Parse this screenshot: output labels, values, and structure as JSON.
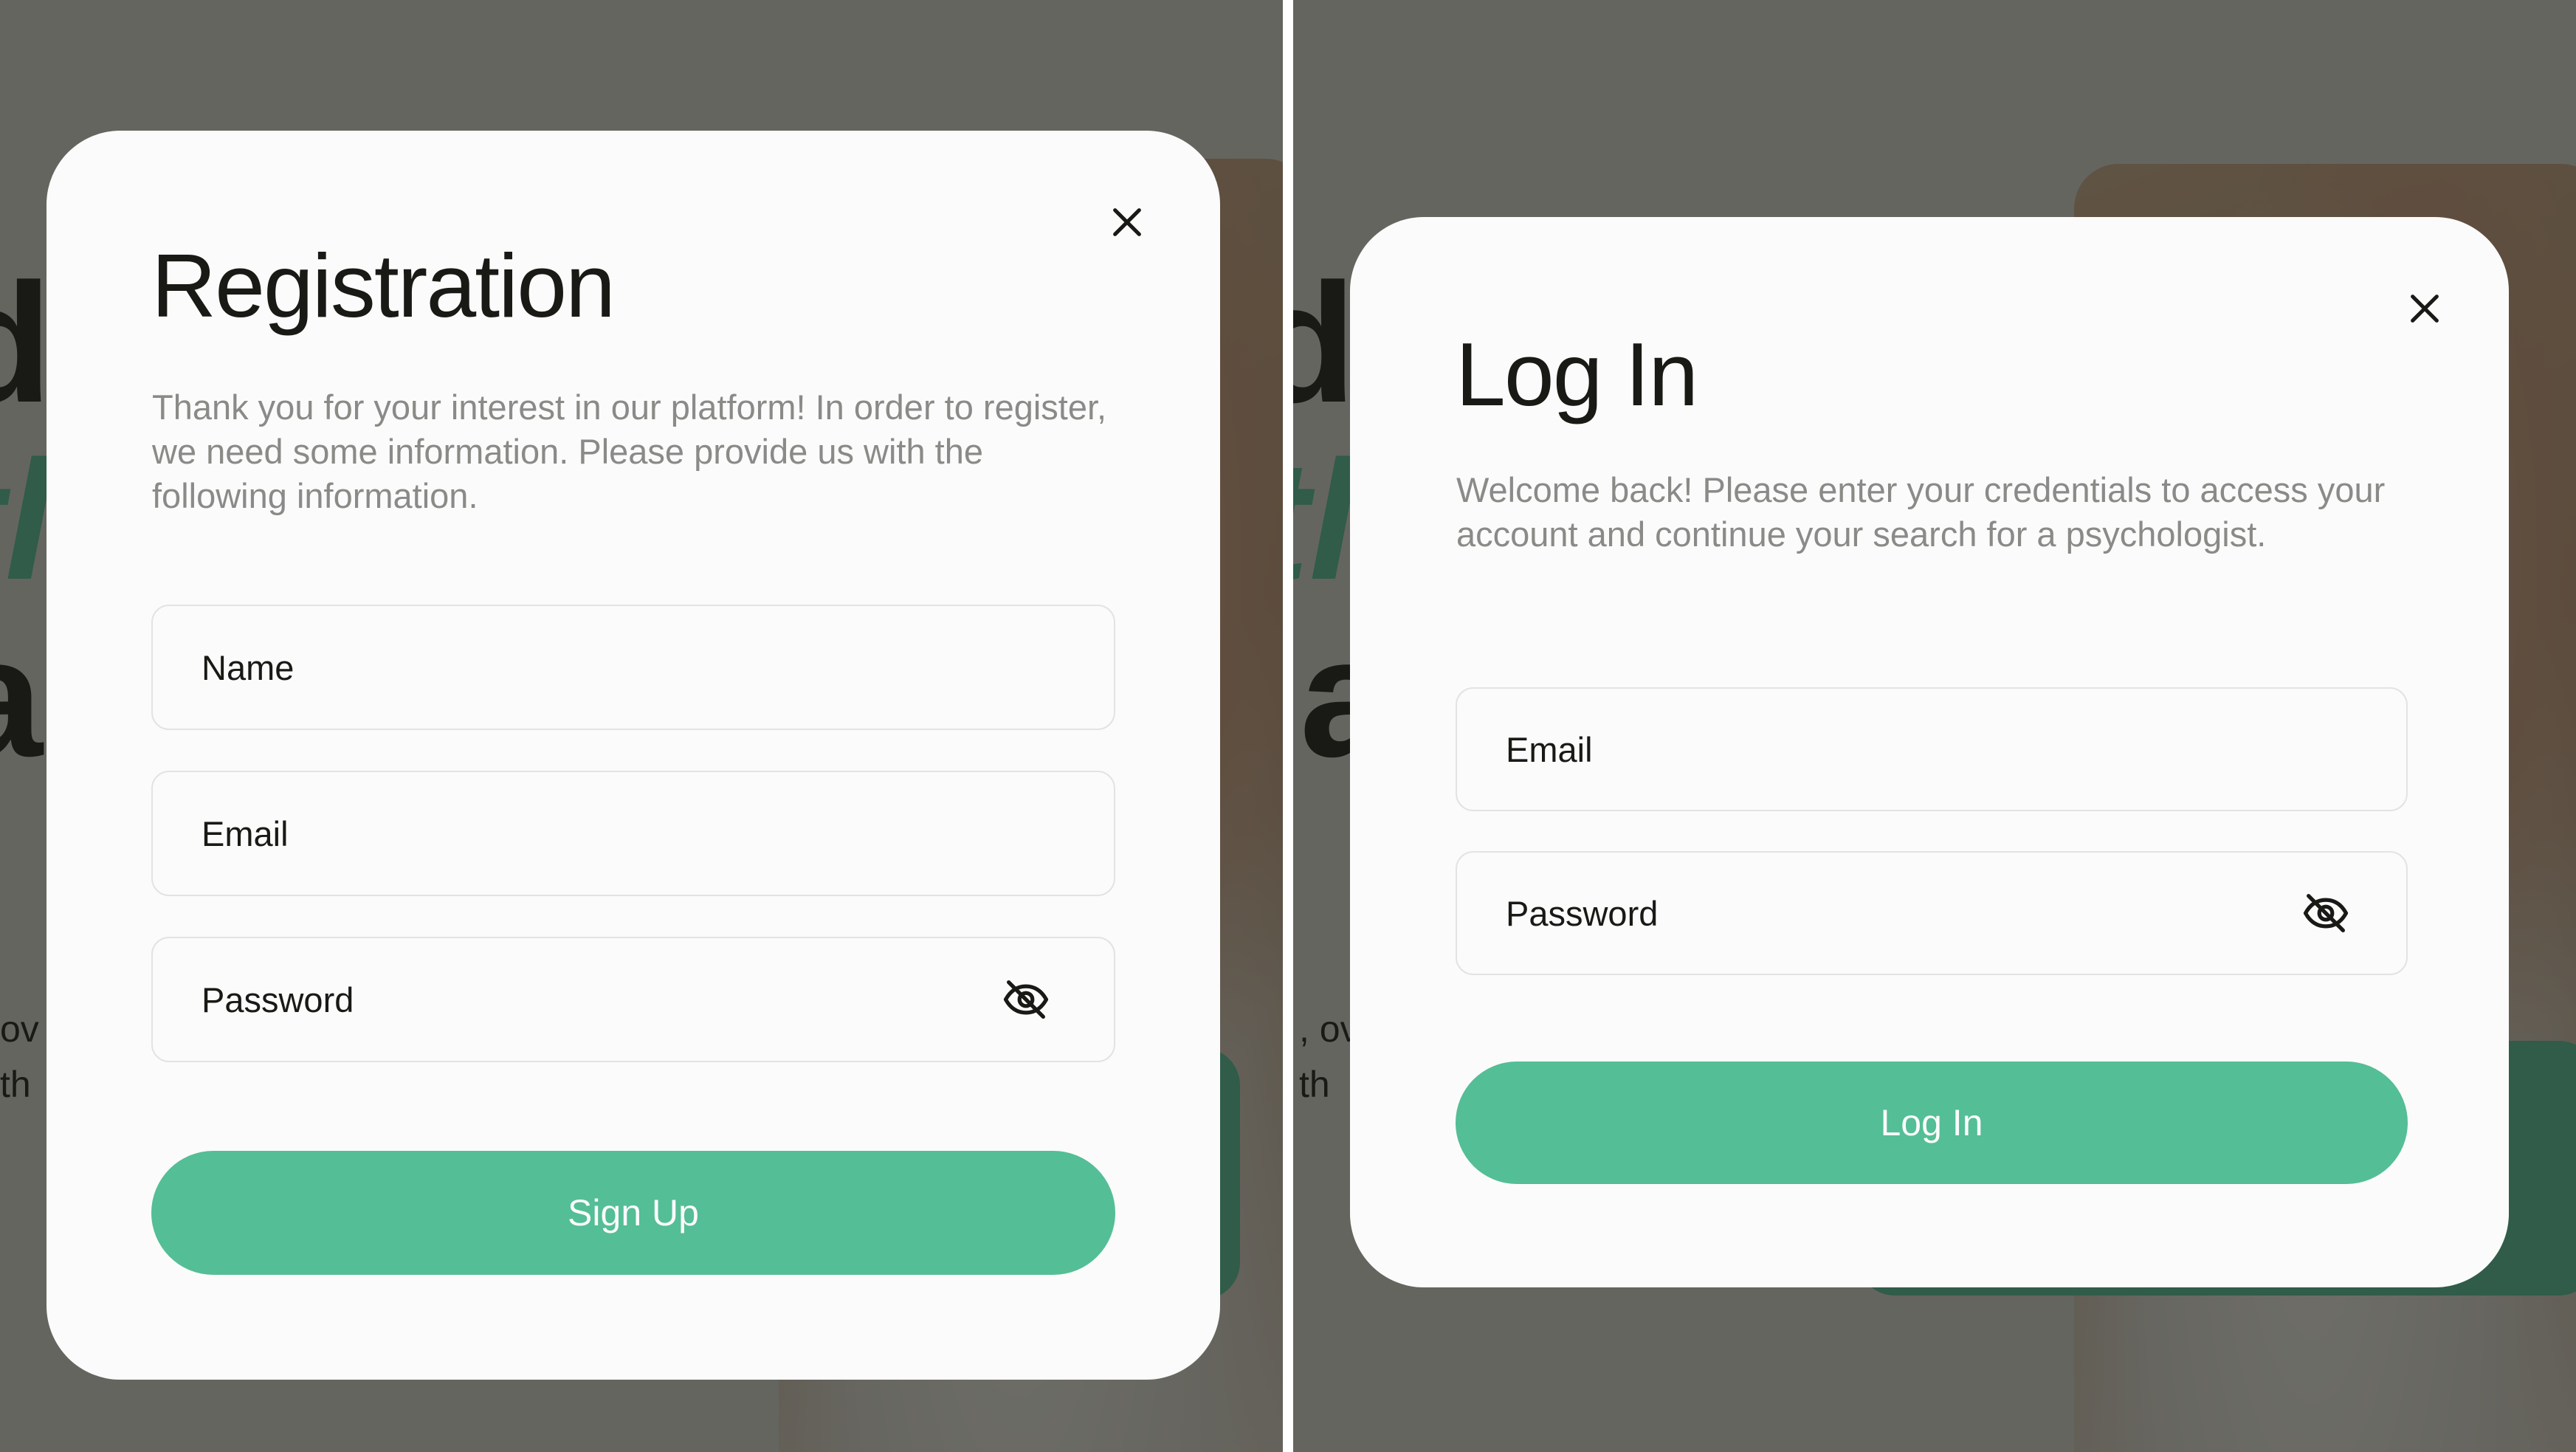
{
  "colors": {
    "accent": "#54be96",
    "overlay": "rgba(25,26,21,0.6)",
    "modal_bg": "#fbfbfb",
    "text_dark": "#191a15",
    "text_muted": "#8a8a87",
    "field_border": "#e3e3e3"
  },
  "registration": {
    "title": "Registration",
    "description": "Thank you for your interest in our platform! In order to register, we need some information. Please provide us with the following information.",
    "name_placeholder": "Name",
    "email_placeholder": "Email",
    "password_placeholder": "Password",
    "submit_label": "Sign Up",
    "close_icon": "close-icon",
    "password_toggle_icon": "eye-off-icon"
  },
  "login": {
    "title": "Log In",
    "description": "Welcome back! Please enter your credentials to access your account and continue your search for a psychologist.",
    "email_placeholder": "Email",
    "password_placeholder": "Password",
    "submit_label": "Log In",
    "close_icon": "close-icon",
    "password_toggle_icon": "eye-off-icon"
  }
}
